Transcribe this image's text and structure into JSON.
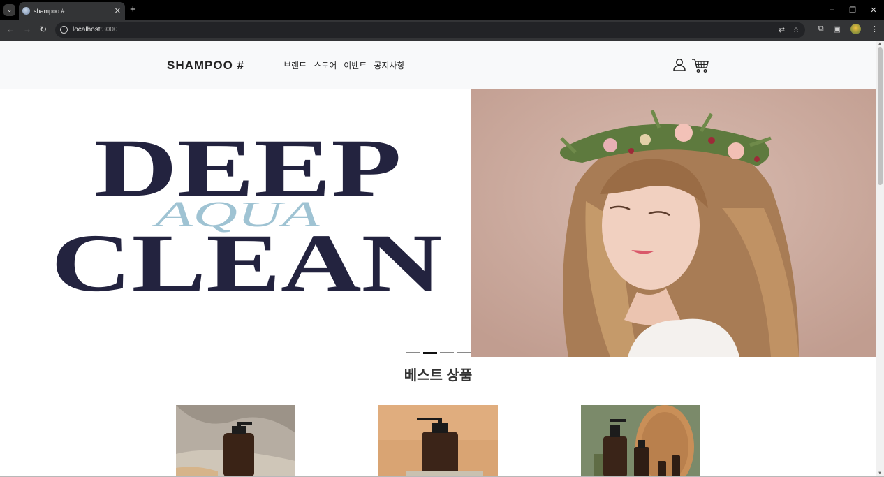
{
  "browser": {
    "tab_title": "shampoo #",
    "url_host": "localhost",
    "url_port": ":3000"
  },
  "site": {
    "logo": "SHAMPOO #",
    "nav": [
      "브랜드",
      "스토어",
      "이벤트",
      "공지사항"
    ]
  },
  "hero": {
    "word_top": "DEEP",
    "word_middle": "AQUA",
    "word_bottom": "CLEAN",
    "slide_count": 4,
    "active_slide": 2
  },
  "best": {
    "title": "베스트 상품"
  },
  "colors": {
    "navy": "#23233f",
    "aqua": "#9fc3d3",
    "header_bg": "#f8f9fa"
  }
}
